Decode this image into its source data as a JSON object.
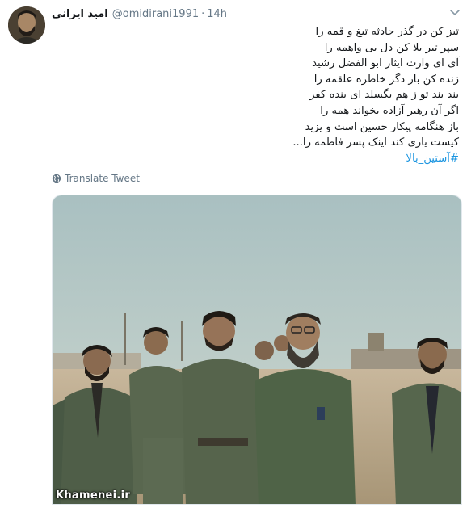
{
  "tweet": {
    "display_name": "امید ایرانی",
    "handle": "@omidirani1991",
    "separator": "·",
    "time": "14h",
    "lines": [
      "تیز کن در گذر حادثه تیغ و قمه را",
      "سپر تیر بلا کن دل بی واهمه را",
      "آی ای وارث ایثار ابو الفضل رشید",
      "زنده کن بار دگر خاطره علقمه را",
      "بند بند تو ز هم بگسلد ای بنده کفر",
      "اگر آن رهبر آزاده بخواند همه را",
      "باز هنگامه پیکار حسین است و یزید",
      "کیست یاری کند اینک پسر فاطمه را..."
    ],
    "hashtag": "#آستین_بالا"
  },
  "translate": {
    "label": "Translate Tweet",
    "icon": "globe-icon"
  },
  "photo": {
    "watermark": "Khamenei.ir",
    "icon": "photo-of-men-in-uniform"
  },
  "colors": {
    "link": "#1b95e0",
    "muted": "#657786",
    "text": "#14171a"
  }
}
